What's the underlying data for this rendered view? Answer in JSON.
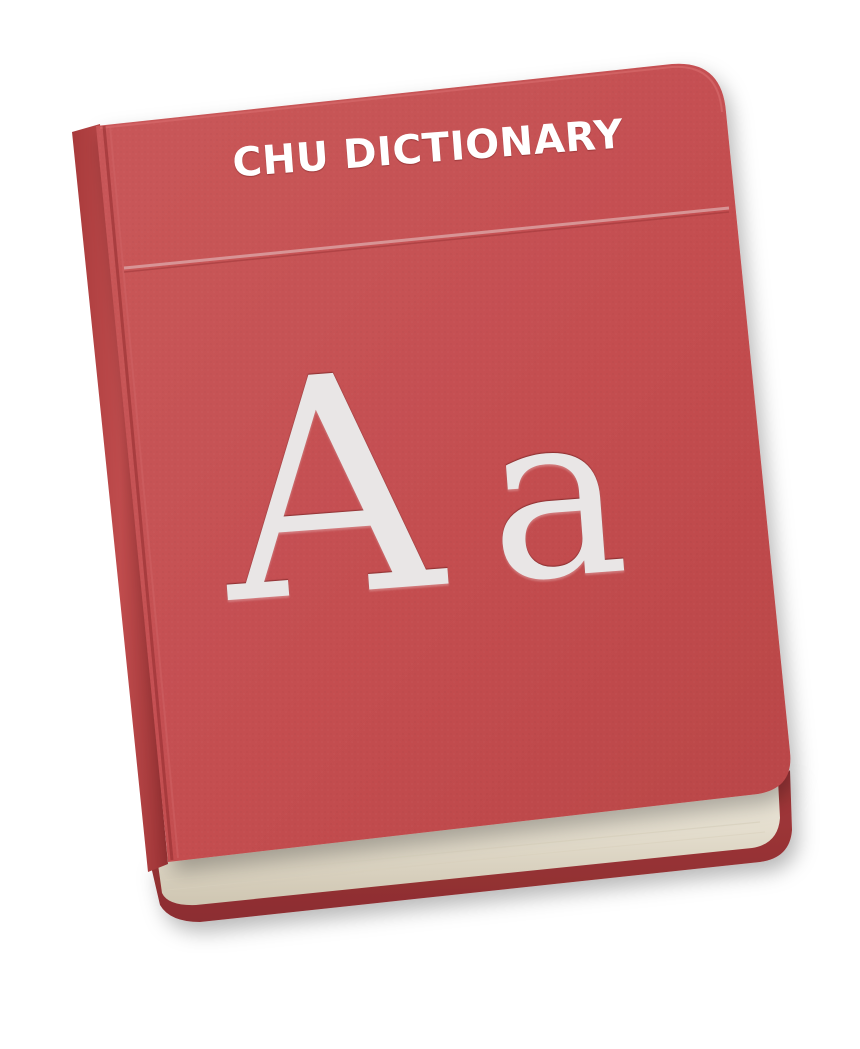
{
  "cover": {
    "title": "CHU DICTIONARY",
    "glyph_upper": "A",
    "glyph_lower": "a"
  },
  "colors": {
    "cover": "#c44e50",
    "cover_dark": "#a9393c",
    "spine": "#b6403f",
    "pages": "#ece6d6",
    "text": "#ffffff"
  },
  "icon": "dictionary-book-icon"
}
